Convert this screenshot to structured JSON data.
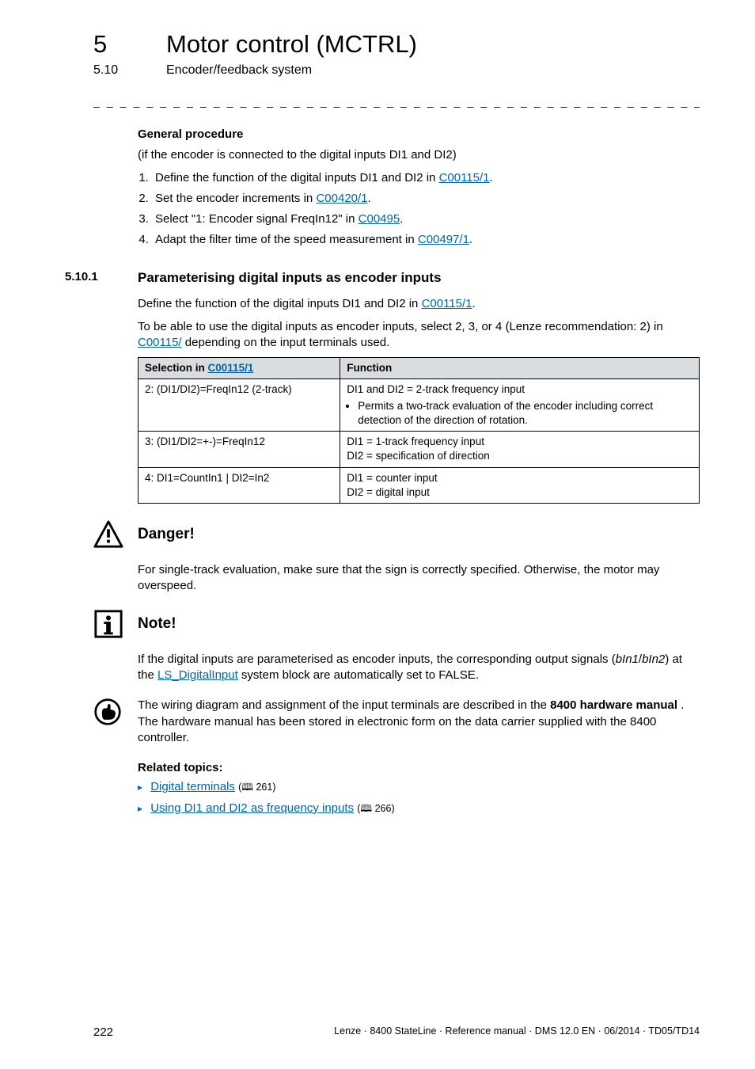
{
  "chapter": {
    "number": "5",
    "title": "Motor control (MCTRL)"
  },
  "subsection": {
    "number": "5.10",
    "title": "Encoder/feedback system"
  },
  "dash_rule": "_ _ _ _ _ _ _ _ _ _ _ _ _ _ _ _ _ _ _ _ _ _ _ _ _ _ _ _ _ _ _ _ _ _ _ _ _ _ _ _ _ _ _ _ _ _ _ _ _ _ _ _ _ _ _ _ _ _ _ _ _ _ _ _",
  "body": {
    "gp_heading": "General procedure",
    "gp_intro": "(if the encoder is connected to the digital inputs DI1 and DI2)",
    "steps": [
      {
        "pre": "Define the function of the digital inputs DI1 and DI2 in ",
        "link": "C00115/1",
        "post": "."
      },
      {
        "pre": "Set the encoder increments in ",
        "link": "C00420/1",
        "post": "."
      },
      {
        "pre": "Select \"1: Encoder signal FreqIn12\" in ",
        "link": "C00495",
        "post": "."
      },
      {
        "pre": "Adapt the filter time of the speed measurement in ",
        "link": "C00497/1",
        "post": "."
      }
    ],
    "section": {
      "number": "5.10.1",
      "title": "Parameterising digital inputs as encoder inputs"
    },
    "sec_intro_pre": "Define the function of the digital inputs DI1 and DI2 in ",
    "sec_intro_link": "C00115/1",
    "sec_intro_post": ".",
    "sec_para2_pre": "To be able to use the digital inputs as encoder inputs, select 2, 3, or 4 (Lenze recommendation: 2) in ",
    "sec_para2_link": "C00115/",
    "sec_para2_post": " depending on the input terminals used.",
    "table": {
      "head_sel_pre": "Selection in ",
      "head_sel_link": "C00115/1",
      "head_func": "Function",
      "rows": [
        {
          "sel": "2: (DI1/DI2)=FreqIn12 (2-track)",
          "func_line1": "DI1 and DI2 = 2-track frequency input",
          "func_bullet": "Permits a two-track evaluation of the encoder including correct detection of the direction of rotation."
        },
        {
          "sel": "3: (DI1/DI2=+-)=FreqIn12",
          "func_line1": "DI1 = 1-track frequency input",
          "func_line2": "DI2 = specification of direction"
        },
        {
          "sel": "4: DI1=CountIn1 | DI2=In2",
          "func_line1": "DI1 = counter input",
          "func_line2": "DI2 = digital input"
        }
      ]
    },
    "danger": {
      "title": "Danger!",
      "text": "For single-track evaluation, make sure that the sign is correctly specified. Otherwise, the motor may overspeed."
    },
    "note": {
      "title": "Note!",
      "text_pre": "If the digital inputs are parameterised as encoder inputs, the corresponding output signals (",
      "em1": "bIn1",
      "slash": "/",
      "em2": "bIn2",
      "text_mid": ") at the ",
      "link": "LS_DigitalInput",
      "text_post": " system block are automatically set to FALSE."
    },
    "tip": {
      "text_pre": "The wiring diagram and assignment of the input terminals are described in the ",
      "bold": "8400 hardware manual",
      "text_post": " . The hardware manual has been stored in electronic form on the data carrier supplied with the 8400 controller."
    },
    "related": {
      "heading": "Related topics:",
      "items": [
        {
          "link": "Digital terminals",
          "page": "261"
        },
        {
          "link": "Using DI1 and DI2 as frequency inputs",
          "page": "266"
        }
      ]
    }
  },
  "footer": {
    "page": "222",
    "right": "Lenze · 8400 StateLine · Reference manual · DMS 12.0 EN · 06/2014 · TD05/TD14"
  },
  "icons": {
    "danger": "warning-triangle-icon",
    "note": "info-box-icon",
    "tip": "hand-point-icon",
    "book": "book-icon"
  }
}
